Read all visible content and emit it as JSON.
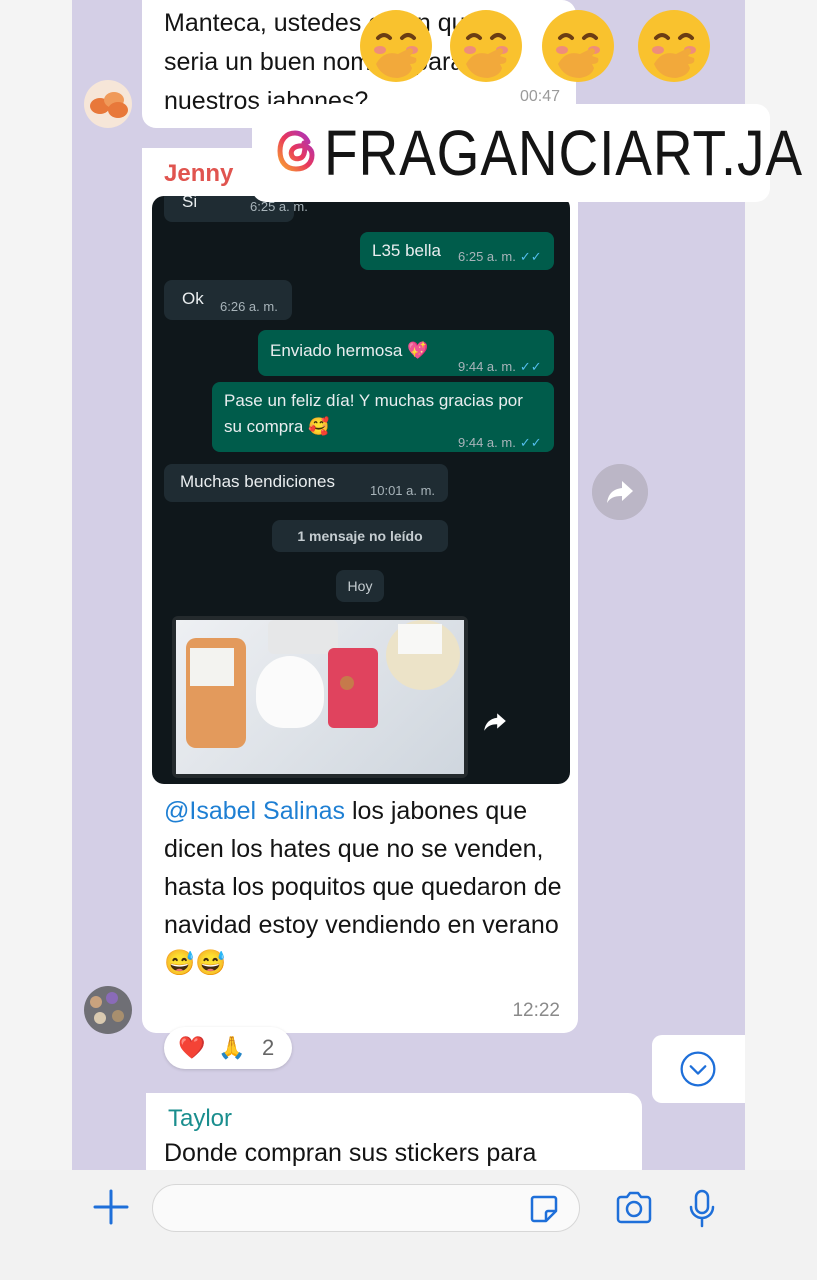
{
  "messages": {
    "first": {
      "text": "Manteca, ustedes creen que\nseria un buen nombre para\nnuestros jabones?",
      "time": "00:47"
    },
    "jenny": {
      "sender": "Jenny",
      "caption_mention": "@Isabel Salinas",
      "caption_text": " los jabones que dicen los hates que no se venden, hasta los poquitos que quedaron de navidad estoy vendiendo en verano",
      "caption_emoji": "😅😅",
      "time": "12:22",
      "reactions": {
        "emoji_1": "❤️",
        "emoji_2": "🙏",
        "count": "2"
      }
    },
    "taylor": {
      "sender": "Taylor",
      "text": "Donde compran sus stickers para"
    }
  },
  "screenshot": {
    "msg_si": {
      "text": "Si",
      "time": "6:25 a. m."
    },
    "msg_l35": {
      "text": "L35 bella",
      "time": "6:25 a. m."
    },
    "msg_ok": {
      "text": "Ok",
      "time": "6:26 a. m."
    },
    "msg_enviado": {
      "text": "Enviado hermosa 💖",
      "time": "9:44 a. m."
    },
    "msg_feliz": {
      "text": "Pase un feliz día! Y muchas gracias por su compra 🥰",
      "time": "9:44 a. m."
    },
    "msg_bendiciones": {
      "text": "Muchas bendiciones",
      "time": "10:01 a. m."
    },
    "unread": "1 mensaje no leído",
    "today": "Hoy",
    "read_ticks": "✓✓"
  },
  "overlay": {
    "handle": "FRAGANCIART.JA",
    "emojis": [
      "🤭",
      "🤭",
      "🤭",
      "🤭"
    ]
  },
  "icons": {
    "plus": "plus-icon",
    "sticker": "sticker-icon",
    "camera": "camera-icon",
    "mic": "microphone-icon",
    "forward": "forward-icon",
    "chevron": "chevron-down-icon",
    "instagram": "threads-logo-icon"
  },
  "colors": {
    "chat_bg": "#d4cfe6",
    "jenny_name": "#e0544f",
    "taylor_name": "#1a8e8e",
    "mention": "#1e7fd3",
    "wa_out": "#005c4b",
    "wa_in": "#1f2c33",
    "accent_blue": "#1e6fd9"
  }
}
